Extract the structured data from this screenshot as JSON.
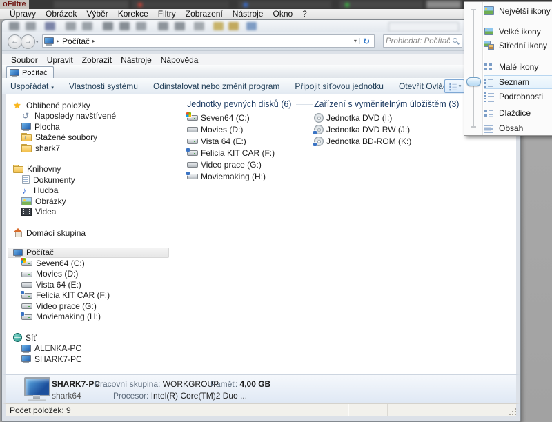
{
  "taskbar": {
    "app_title": "oFiltre"
  },
  "photofiltre": {
    "menu": [
      "Úpravy",
      "Obrázek",
      "Výběr",
      "Korekce",
      "Filtry",
      "Zobrazení",
      "Nástroje",
      "Okno",
      "?"
    ]
  },
  "explorer": {
    "nav": {
      "back_icon": "←",
      "forward_icon": "→",
      "history_arrow": "▾",
      "breadcrumb_sep": "▸",
      "breadcrumb": "Počítač",
      "dropdown_icon": "▾",
      "refresh_icon": "↻",
      "search_placeholder": "Prohledat: Počítač"
    },
    "menubar": {
      "items": [
        "Soubor",
        "Upravit",
        "Zobrazit",
        "Nástroje",
        "Nápověda"
      ]
    },
    "tab": {
      "label": "Počítač"
    },
    "toolbar": {
      "organize": "Uspořádat",
      "organize_arrow": "▾",
      "buttons": [
        "Vlastnosti systému",
        "Odinstalovat nebo změnit program",
        "Připojit síťovou jednotku",
        "Otevřít Ovládací panely"
      ],
      "views_arrow": "▾"
    },
    "sidebar": {
      "favorites": {
        "label": "Oblíbené položky",
        "items": [
          "Naposledy navštívené",
          "Plocha",
          "Stažené soubory",
          "shark7"
        ]
      },
      "libraries": {
        "label": "Knihovny",
        "items": [
          "Dokumenty",
          "Hudba",
          "Obrázky",
          "Videa"
        ]
      },
      "homegroup": {
        "label": "Domácí skupina"
      },
      "computer": {
        "label": "Počítač",
        "items": [
          "Seven64 (C:)",
          "Movies (D:)",
          "Vista 64 (E:)",
          "Felicia KIT CAR (F:)",
          "Video prace (G:)",
          "Moviemaking (H:)"
        ]
      },
      "network": {
        "label": "Síť",
        "items": [
          "ALENKA-PC",
          "SHARK7-PC"
        ]
      }
    },
    "main": {
      "groups": [
        {
          "title": "Jednotky pevných disků (6)",
          "items": [
            "Seven64 (C:)",
            "Movies (D:)",
            "Vista 64 (E:)",
            "Felicia KIT CAR (F:)",
            "Video prace (G:)",
            "Moviemaking (H:)"
          ]
        },
        {
          "title": "Zařízení s vyměnitelným úložištěm (3)",
          "items": [
            "Jednotka DVD (I:)",
            "Jednotka DVD RW (J:)",
            "Jednotka BD-ROM (K:)"
          ]
        }
      ]
    },
    "details": {
      "computer_name": "SHARK7-PC",
      "user_name": "shark64",
      "workgroup_label": "Pracovní skupina:",
      "workgroup_value": "WORKGROUP",
      "memory_label": "Paměť:",
      "memory_value": "4,00 GB",
      "processor_label": "Procesor:",
      "processor_value": "Intel(R) Core(TM)2 Duo ..."
    },
    "statusbar": {
      "item_count": "Počet položek: 9"
    }
  },
  "views_menu": {
    "items": [
      "Největší ikony",
      "Velké ikony",
      "Střední ikony",
      "Malé ikony",
      "Seznam",
      "Podrobnosti",
      "Dlaždice",
      "Obsah"
    ],
    "selected": "Seznam"
  },
  "colors": {
    "accent_blue": "#70a0c6",
    "menu_highlight": "#e2f0fb",
    "group_header": "#1e3c64",
    "toolbar_text": "#1e3c55"
  }
}
